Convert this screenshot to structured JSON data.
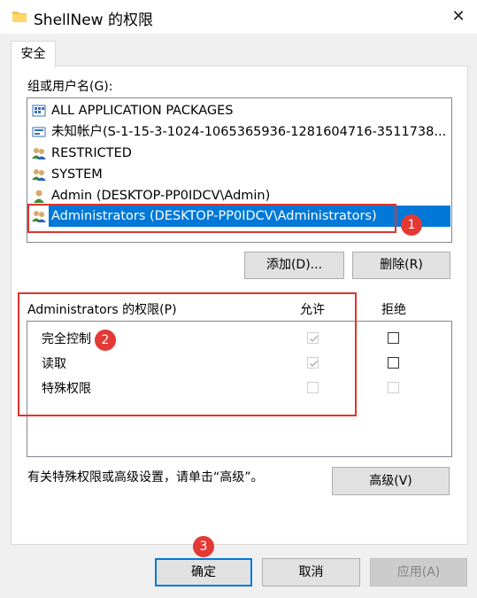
{
  "window": {
    "title": "ShellNew 的权限",
    "close_glyph": "✕"
  },
  "tabs": [
    {
      "label": "安全",
      "active": true
    }
  ],
  "groups": {
    "label": "组或用户名(G):",
    "items": [
      {
        "name": "ALL APPLICATION PACKAGES",
        "icon": "packages-icon"
      },
      {
        "name": "未知帐户(S-1-15-3-1024-1065365936-1281604716-3511738...",
        "icon": "unknown-account-icon"
      },
      {
        "name": "RESTRICTED",
        "icon": "group-icon"
      },
      {
        "name": "SYSTEM",
        "icon": "group-icon"
      },
      {
        "name": "Admin (DESKTOP-PP0IDCV\\Admin)",
        "icon": "user-icon"
      },
      {
        "name": "Administrators (DESKTOP-PP0IDCV\\Administrators)",
        "icon": "group-icon",
        "selected": true
      }
    ],
    "add_button": "添加(D)...",
    "remove_button": "删除(R)"
  },
  "permissions": {
    "header": "Administrators 的权限(P)",
    "allow_header": "允许",
    "deny_header": "拒绝",
    "rows": [
      {
        "name": "完全控制",
        "allow": "checked-disabled",
        "deny": "unchecked"
      },
      {
        "name": "读取",
        "allow": "checked-disabled",
        "deny": "unchecked"
      },
      {
        "name": "特殊权限",
        "allow": "unchecked-disabled",
        "deny": "unchecked-disabled"
      }
    ]
  },
  "advanced": {
    "text": "有关特殊权限或高级设置，请单击“高级”。",
    "button": "高级(V)"
  },
  "footer": {
    "ok": "确定",
    "cancel": "取消",
    "apply": "应用(A)"
  },
  "annotations": {
    "badge1": "1",
    "badge2": "2",
    "badge3": "3",
    "color": "#e53935"
  },
  "colors": {
    "selection": "#0078d7",
    "highlight_border": "#e0332c"
  }
}
